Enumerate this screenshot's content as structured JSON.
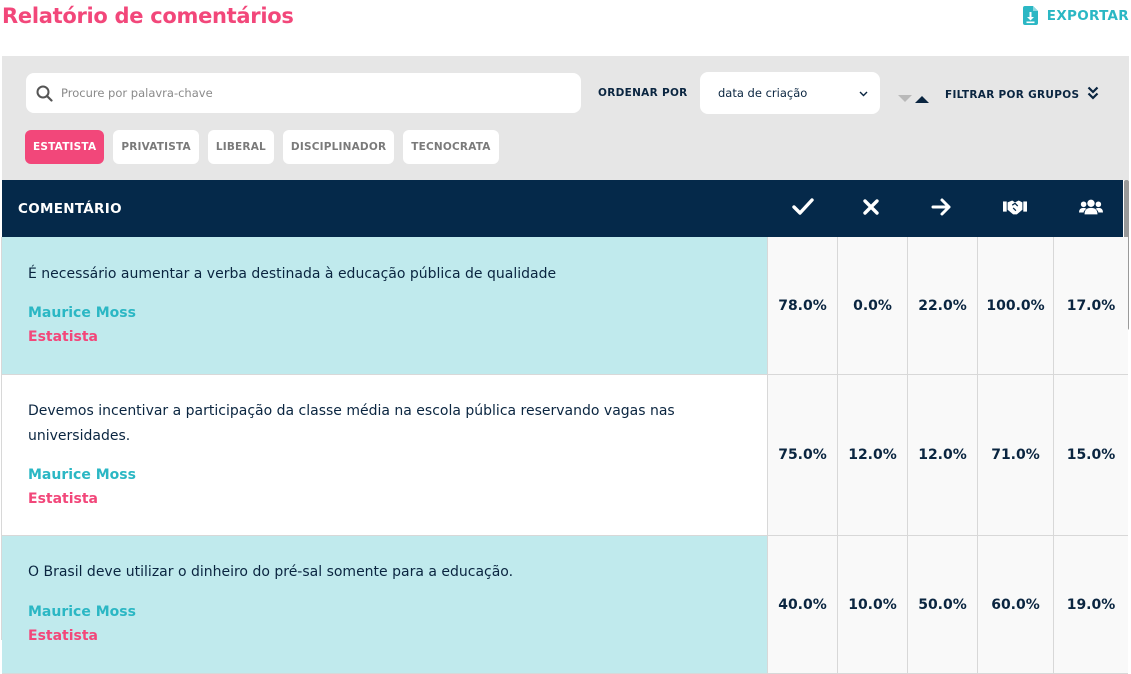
{
  "header": {
    "title": "Relatório de comentários",
    "export_label": "EXPORTAR"
  },
  "filters": {
    "search_placeholder": "Procure por palavra-chave",
    "order_label": "ORDENAR POR",
    "order_value": "data de criação",
    "filter_groups_label": "FILTRAR POR GRUPOS",
    "chips": [
      {
        "label": "ESTATISTA",
        "active": true
      },
      {
        "label": "PRIVATISTA",
        "active": false
      },
      {
        "label": "LIBERAL",
        "active": false
      },
      {
        "label": "DISCIPLINADOR",
        "active": false
      },
      {
        "label": "TECNOCRATA",
        "active": false
      }
    ]
  },
  "table": {
    "comment_header": "COMENTÁRIO",
    "column_icons": [
      "check-icon",
      "close-icon",
      "arrow-right-icon",
      "handshake-icon",
      "users-icon"
    ],
    "rows": [
      {
        "text": "É necessário aumentar a verba destinada à educação pública de qualidade",
        "author": "Maurice Moss",
        "group": "Estatista",
        "values": [
          "78.0%",
          "0.0%",
          "22.0%",
          "100.0%",
          "17.0%"
        ]
      },
      {
        "text": "Devemos incentivar a participação da classe média na escola pública reservando vagas nas universidades.",
        "author": "Maurice Moss",
        "group": "Estatista",
        "values": [
          "75.0%",
          "12.0%",
          "12.0%",
          "71.0%",
          "15.0%"
        ]
      },
      {
        "text": "O Brasil deve utilizar o dinheiro do pré-sal somente para a educação.",
        "author": "Maurice Moss",
        "group": "Estatista",
        "values": [
          "40.0%",
          "10.0%",
          "50.0%",
          "60.0%",
          "19.0%"
        ]
      }
    ]
  },
  "colors": {
    "brand_pink": "#f2477a",
    "accent_teal": "#2bb7c4",
    "header_navy": "#05294a",
    "highlight_row": "#c0eaed"
  }
}
